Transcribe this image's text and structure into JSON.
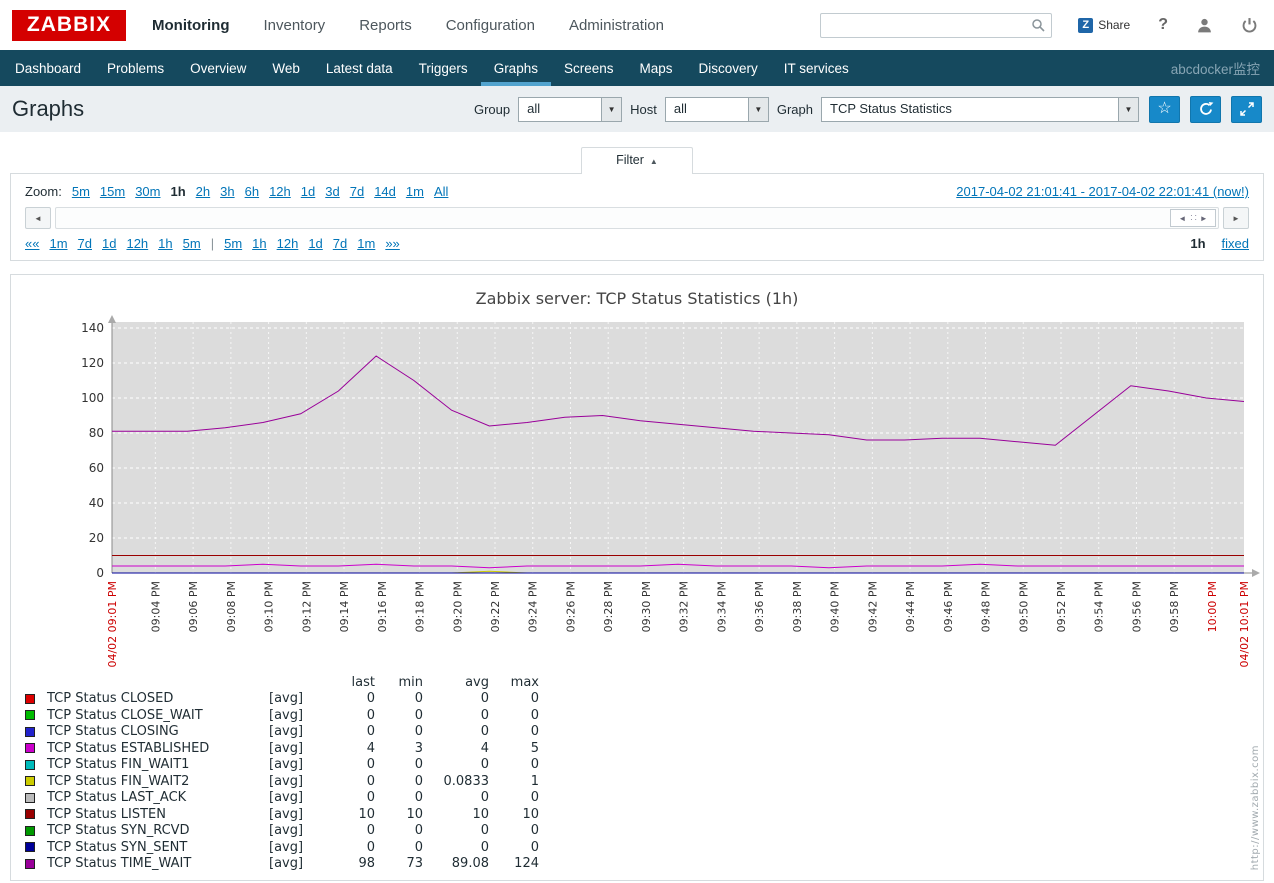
{
  "colors": {
    "brand_red": "#D40000",
    "nav_bg": "#15495E",
    "nav_accent": "#52A3CE",
    "button_blue": "#1789C9",
    "link_blue": "#0275B8",
    "titlebar_bg": "#EBEFF2"
  },
  "icons": {
    "dropdown_arrow": "▼",
    "star": "☆",
    "scroll_left": "◄",
    "scroll_right": "►",
    "handle_left": "◄",
    "handle_grip": "∷",
    "handle_right": "►"
  },
  "header": {
    "logo": "ZABBIX",
    "menu": [
      {
        "label": "Monitoring",
        "active": true
      },
      {
        "label": "Inventory",
        "active": false
      },
      {
        "label": "Reports",
        "active": false
      },
      {
        "label": "Configuration",
        "active": false
      },
      {
        "label": "Administration",
        "active": false
      }
    ],
    "search_placeholder": "",
    "share_icon": "Z",
    "share_label": "Share",
    "help_label": "?"
  },
  "subnav": {
    "items": [
      "Dashboard",
      "Problems",
      "Overview",
      "Web",
      "Latest data",
      "Triggers",
      "Graphs",
      "Screens",
      "Maps",
      "Discovery",
      "IT services"
    ],
    "active": "Graphs",
    "host_label": "abcdocker监控"
  },
  "toolbar": {
    "title": "Graphs",
    "group_label": "Group",
    "group_value": "all",
    "host_label": "Host",
    "host_value": "all",
    "graph_label": "Graph",
    "graph_value": "TCP Status Statistics"
  },
  "filter_tab": {
    "label": "Filter",
    "caret": "▲"
  },
  "timebar": {
    "zoom_label": "Zoom:",
    "zoom_options": [
      "5m",
      "15m",
      "30m",
      "1h",
      "2h",
      "3h",
      "6h",
      "12h",
      "1d",
      "3d",
      "7d",
      "14d",
      "1m",
      "All"
    ],
    "zoom_active": "1h",
    "range_text": "2017-04-02 21:01:41 - 2017-04-02 22:01:41 (now!)",
    "move_back": [
      "««",
      "1m",
      "7d",
      "1d",
      "12h",
      "1h",
      "5m"
    ],
    "move_fwd": [
      "5m",
      "1h",
      "12h",
      "1d",
      "7d",
      "1m",
      "»»"
    ],
    "separator": "|",
    "period": "1h",
    "fixed_label": "fixed"
  },
  "chart_data": {
    "type": "line",
    "title": "Zabbix server: TCP Status Statistics (1h)",
    "ylim": [
      0,
      140
    ],
    "y_ticks": [
      0,
      20,
      40,
      60,
      80,
      100,
      120,
      140
    ],
    "x_range_minutes": [
      0,
      60
    ],
    "grid": true,
    "legend_position": "bottom-left",
    "legend_headers": [
      "last",
      "min",
      "avg",
      "max"
    ],
    "watermark": "http://www.zabbix.com",
    "x": [
      0,
      2,
      4,
      6,
      8,
      10,
      12,
      14,
      16,
      18,
      20,
      22,
      24,
      26,
      28,
      30,
      32,
      34,
      36,
      38,
      40,
      42,
      44,
      46,
      48,
      50,
      52,
      54,
      56,
      58,
      60
    ],
    "x_ticks": [
      {
        "m": 0,
        "label": "04/02 09:01 PM",
        "red": true
      },
      {
        "m": 2.3,
        "label": "09:04 PM",
        "red": false
      },
      {
        "m": 4.3,
        "label": "09:06 PM",
        "red": false
      },
      {
        "m": 6.3,
        "label": "09:08 PM",
        "red": false
      },
      {
        "m": 8.3,
        "label": "09:10 PM",
        "red": false
      },
      {
        "m": 10.3,
        "label": "09:12 PM",
        "red": false
      },
      {
        "m": 12.3,
        "label": "09:14 PM",
        "red": false
      },
      {
        "m": 14.3,
        "label": "09:16 PM",
        "red": false
      },
      {
        "m": 16.3,
        "label": "09:18 PM",
        "red": false
      },
      {
        "m": 18.3,
        "label": "09:20 PM",
        "red": false
      },
      {
        "m": 20.3,
        "label": "09:22 PM",
        "red": false
      },
      {
        "m": 22.3,
        "label": "09:24 PM",
        "red": false
      },
      {
        "m": 24.3,
        "label": "09:26 PM",
        "red": false
      },
      {
        "m": 26.3,
        "label": "09:28 PM",
        "red": false
      },
      {
        "m": 28.3,
        "label": "09:30 PM",
        "red": false
      },
      {
        "m": 30.3,
        "label": "09:32 PM",
        "red": false
      },
      {
        "m": 32.3,
        "label": "09:34 PM",
        "red": false
      },
      {
        "m": 34.3,
        "label": "09:36 PM",
        "red": false
      },
      {
        "m": 36.3,
        "label": "09:38 PM",
        "red": false
      },
      {
        "m": 38.3,
        "label": "09:40 PM",
        "red": false
      },
      {
        "m": 40.3,
        "label": "09:42 PM",
        "red": false
      },
      {
        "m": 42.3,
        "label": "09:44 PM",
        "red": false
      },
      {
        "m": 44.3,
        "label": "09:46 PM",
        "red": false
      },
      {
        "m": 46.3,
        "label": "09:48 PM",
        "red": false
      },
      {
        "m": 48.3,
        "label": "09:50 PM",
        "red": false
      },
      {
        "m": 50.3,
        "label": "09:52 PM",
        "red": false
      },
      {
        "m": 52.3,
        "label": "09:54 PM",
        "red": false
      },
      {
        "m": 54.3,
        "label": "09:56 PM",
        "red": false
      },
      {
        "m": 56.3,
        "label": "09:58 PM",
        "red": false
      },
      {
        "m": 58.3,
        "label": "10:00 PM",
        "red": true
      },
      {
        "m": 60,
        "label": "04/02 10:01 PM",
        "red": true
      }
    ],
    "series": [
      {
        "name": "TCP Status CLOSED",
        "mode": "[avg]",
        "color": "#DD0000",
        "flat": 0,
        "stats": {
          "last": "0",
          "min": "0",
          "avg": "0",
          "max": "0"
        }
      },
      {
        "name": "TCP Status CLOSE_WAIT",
        "mode": "[avg]",
        "color": "#00BB00",
        "flat": 0,
        "stats": {
          "last": "0",
          "min": "0",
          "avg": "0",
          "max": "0"
        }
      },
      {
        "name": "TCP Status CLOSING",
        "mode": "[avg]",
        "color": "#2222CC",
        "flat": 0,
        "stats": {
          "last": "0",
          "min": "0",
          "avg": "0",
          "max": "0"
        }
      },
      {
        "name": "TCP Status ESTABLISHED",
        "mode": "[avg]",
        "color": "#CC00CC",
        "values": [
          4,
          4,
          4,
          4,
          5,
          4,
          4,
          5,
          4,
          4,
          3,
          4,
          4,
          4,
          4,
          5,
          4,
          4,
          4,
          3,
          4,
          4,
          4,
          5,
          4,
          4,
          4,
          4,
          4,
          4,
          4
        ],
        "stats": {
          "last": "4",
          "min": "3",
          "avg": "4",
          "max": "5"
        }
      },
      {
        "name": "TCP Status FIN_WAIT1",
        "mode": "[avg]",
        "color": "#00BBBB",
        "flat": 0,
        "stats": {
          "last": "0",
          "min": "0",
          "avg": "0",
          "max": "0"
        }
      },
      {
        "name": "TCP Status FIN_WAIT2",
        "mode": "[avg]",
        "color": "#CCCC00",
        "values": [
          0,
          0,
          0,
          0,
          0,
          0,
          0,
          0,
          0,
          0,
          1,
          0,
          0,
          0,
          0,
          0,
          0,
          0,
          0,
          0,
          0,
          0,
          0,
          0,
          0,
          0,
          0,
          0,
          0,
          0,
          0
        ],
        "stats": {
          "last": "0",
          "min": "0",
          "avg": "0.0833",
          "max": "1"
        }
      },
      {
        "name": "TCP Status LAST_ACK",
        "mode": "[avg]",
        "color": "#BBBBBB",
        "flat": 0,
        "stats": {
          "last": "0",
          "min": "0",
          "avg": "0",
          "max": "0"
        }
      },
      {
        "name": "TCP Status LISTEN",
        "mode": "[avg]",
        "color": "#990000",
        "flat": 10,
        "stats": {
          "last": "10",
          "min": "10",
          "avg": "10",
          "max": "10"
        }
      },
      {
        "name": "TCP Status SYN_RCVD",
        "mode": "[avg]",
        "color": "#009900",
        "flat": 0,
        "stats": {
          "last": "0",
          "min": "0",
          "avg": "0",
          "max": "0"
        }
      },
      {
        "name": "TCP Status SYN_SENT",
        "mode": "[avg]",
        "color": "#000099",
        "flat": 0,
        "stats": {
          "last": "0",
          "min": "0",
          "avg": "0",
          "max": "0"
        }
      },
      {
        "name": "TCP Status TIME_WAIT",
        "mode": "[avg]",
        "color": "#990099",
        "values": [
          81,
          81,
          81,
          83,
          86,
          91,
          104,
          124,
          110,
          93,
          84,
          86,
          89,
          90,
          87,
          85,
          83,
          81,
          80,
          79,
          76,
          76,
          77,
          77,
          75,
          73,
          90,
          107,
          104,
          100,
          98
        ],
        "stats": {
          "last": "98",
          "min": "73",
          "avg": "89.08",
          "max": "124"
        }
      }
    ]
  }
}
